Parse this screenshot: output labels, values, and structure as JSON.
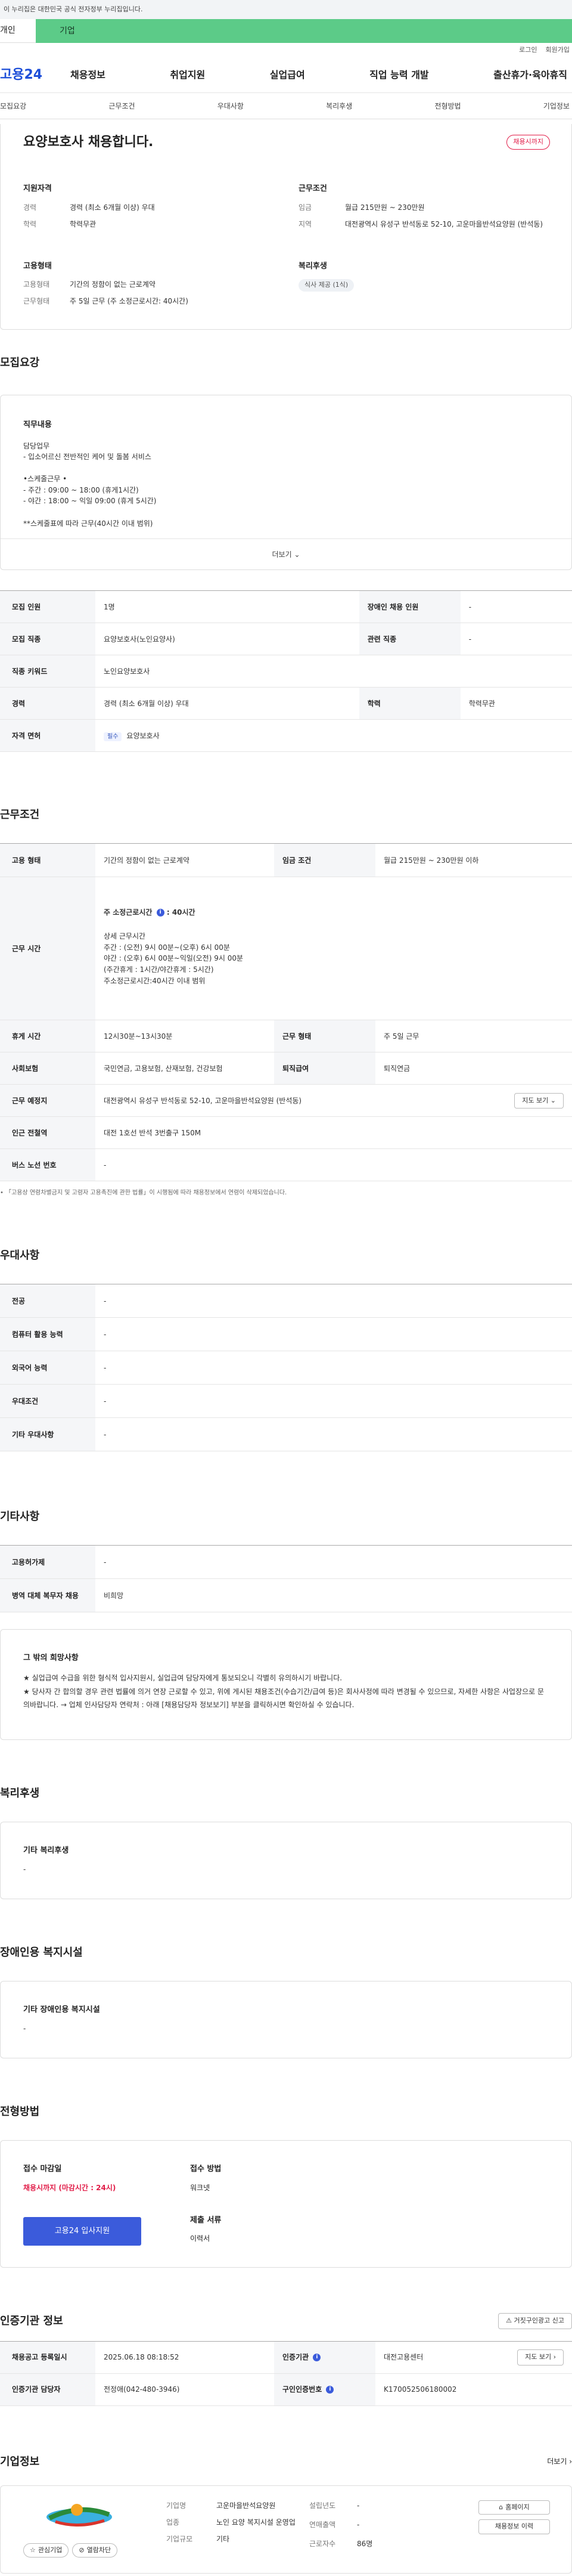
{
  "gov_banner": "이 누리집은 대한민국 공식 전자정부 누리집입니다.",
  "segments": {
    "personal": "개인",
    "corporate": "기업"
  },
  "util": {
    "login": "로그인",
    "join": "회원가입"
  },
  "logo": "고용24",
  "gnb": [
    "채용정보",
    "취업지원",
    "실업급여",
    "직업 능력 개발",
    "출산휴가·육아휴직"
  ],
  "tabs": [
    "모집요강",
    "근무조건",
    "우대사항",
    "복리후생",
    "전형방법",
    "기업정보"
  ],
  "header": {
    "title": "요양보호사 채용합니다.",
    "deadline_badge": "채용시까지",
    "qual_title": "지원자격",
    "career_label": "경력",
    "career_value": "경력 (최소 6개월 이상) 우대",
    "edu_label": "학력",
    "edu_value": "학력무관",
    "work_title": "근무조건",
    "wage_label": "임금",
    "wage_value": "월급 215만원 ~ 230만원",
    "region_label": "지역",
    "region_value": "대전광역시 유성구 반석동로 52-10, 고운마을반석요양원 (반석동)",
    "emp_title": "고용형태",
    "emp_label": "고용형태",
    "emp_value": "기간의 정함이 없는 근로계약",
    "worktype_label": "근무형태",
    "worktype_value": "주 5일 근무 (주 소정근로시간: 40시간)",
    "welfare_title": "복리후생",
    "welfare_chip": "식사 제공 (1식)"
  },
  "recruit": {
    "section_title": "모집요강",
    "duty_title": "직무내용",
    "duty_text": "담당업무\n- 입소어르신 전반적인 케어 및 돌봄 서비스\n\n•스케줄근무 •\n- 주간 : 09:00 ~ 18:00 (휴게1시간)\n- 야간 : 18:00 ~ 익일 09:00 (휴게 5시간)\n\n**스케줄표에 따라 근무(40시간 이내 범위)",
    "more": "더보기",
    "rows": {
      "count_l": "모집 인원",
      "count_v": "1명",
      "disab_l": "장애인 채용 인원",
      "disab_v": "-",
      "job_l": "모집 직종",
      "job_v": "요양보호사(노인요양사)",
      "rel_l": "관련 직종",
      "rel_v": "-",
      "kw_l": "직종 키워드",
      "kw_v": "노인요양보호사",
      "career_l": "경력",
      "career_v": "경력 (최소 6개월 이상) 우대",
      "edu_l": "학력",
      "edu_v": "학력무관",
      "lic_l": "자격 면허",
      "lic_tag": "필수",
      "lic_v": "요양보호사"
    }
  },
  "work": {
    "section_title": "근무조건",
    "emp_l": "고용 형태",
    "emp_v": "기간의 정함이 없는 근로계약",
    "wage_l": "임금 조건",
    "wage_v": "월급 215만원 ~ 230만원 이하",
    "hours_l": "근무 시간",
    "hours_main": "주 소정근로시간",
    "hours_main_v": ": 40시간",
    "hours_detail": "상세 근무시간\n주간 : (오전) 9시 00분~(오후) 6시 00분\n야간 : (오후) 6시 00분~익일(오전) 9시 00분\n(주간휴게 : 1시간/야간휴게 : 5시간)\n주소정근로시간:40시간 이내 범위",
    "rest_l": "휴게 시간",
    "rest_v": "12시30분~13시30분",
    "type_l": "근무 형태",
    "type_v": "주 5일 근무",
    "ins_l": "사회보험",
    "ins_v": "국민연금, 고용보험, 산재보험, 건강보험",
    "sev_l": "퇴직급여",
    "sev_v": "퇴직연금",
    "place_l": "근무 예정지",
    "place_v": "대전광역시 유성구 반석동로 52-10, 고운마을반석요양원 (반석동)",
    "map_btn": "지도 보기",
    "subway_l": "인근 전철역",
    "subway_v": "대전 1호선 반석 3번출구 150M",
    "bus_l": "버스 노선 번호",
    "bus_v": "-",
    "note": "「고용상 연령차별금지 및 고령자 고용촉진에 관한 법률」이 시행됨에 따라 채용정보에서 연령이 삭제되었습니다."
  },
  "pref": {
    "section_title": "우대사항",
    "major_l": "전공",
    "major_v": "-",
    "pc_l": "컴퓨터 활용 능력",
    "pc_v": "-",
    "lang_l": "외국어 능력",
    "lang_v": "-",
    "cond_l": "우대조건",
    "cond_v": "-",
    "etc_l": "기타 우대사항",
    "etc_v": "-"
  },
  "etc": {
    "section_title": "기타사항",
    "lic_l": "고용허가제",
    "lic_v": "-",
    "mil_l": "병역 대체 복무자 채용",
    "mil_v": "비희망",
    "box_title": "그 밖의 희망사항",
    "box_text": "★ 실업급여 수급을 위한 형식적 입사지원시, 실업급여 담당자에게 통보되오니 각별히 유의하시기 바랍니다.\n★ 당사자 간 합의할 경우 관련 법률에 의거 연장 근로할 수 있고, 위에 게시된 채용조건(수습기간/급여 등)은 회사사정에 따라 변경될 수 있으므로, 자세한 사항은 사업장으로 문의바랍니다. → 업체 인사담당자 연락처 : 아래 [채용담당자 정보보기] 부분을 클릭하시면 확인하실 수 있습니다."
  },
  "welfare": {
    "section_title": "복리후생",
    "box_title": "기타 복리후생",
    "box_value": "-"
  },
  "disab": {
    "section_title": "장애인용 복지시설",
    "box_title": "기타 장애인용 복지시설",
    "box_value": "-"
  },
  "process": {
    "section_title": "전형방법",
    "deadline_title": "접수 마감일",
    "deadline_value": "채용시까지 (마감시간 : 24시)",
    "apply_btn": "고용24 입사지원",
    "method_title": "접수 방법",
    "method_value": "워크넷",
    "docs_title": "제출 서류",
    "docs_value": "이력서"
  },
  "cert": {
    "section_title": "인증기관 정보",
    "report_btn": "거짓구인광고 신고",
    "reg_l": "채용공고 등록일시",
    "reg_v": "2025.06.18 08:18:52",
    "org_l": "인증기관",
    "org_v": "대전고용센터",
    "map_btn": "지도 보기",
    "mgr_l": "인증기관 담당자",
    "mgr_v": "전정애(042-480-3946)",
    "num_l": "구인인증번호",
    "num_v": "K170052506180002"
  },
  "company": {
    "section_title": "기업정보",
    "more": "더보기",
    "interest_btn": "관심기업",
    "block_btn": "열람차단",
    "name_l": "기업명",
    "name_v": "고운마을반석요양원",
    "industry_l": "업종",
    "industry_v": "노인 요양 복지시설 운영업",
    "size_l": "기업규모",
    "size_v": "기타",
    "est_l": "설립년도",
    "est_v": "-",
    "sales_l": "연매출액",
    "sales_v": "-",
    "emp_l": "근로자수",
    "emp_v": "86명",
    "homepage_btn": "홈페이지",
    "jobs_btn": "채용정보 이력"
  }
}
